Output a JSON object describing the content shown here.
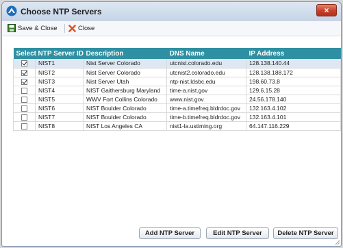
{
  "window": {
    "title": "Choose NTP Servers",
    "close_symbol": "×"
  },
  "toolbar": {
    "save_close_label": "Save & Close",
    "close_label": "Close",
    "save_icon": "save-icon",
    "close_icon": "close-x-icon"
  },
  "table": {
    "columns": [
      "Select",
      "NTP Server ID",
      "Description",
      "DNS Name",
      "IP Address"
    ],
    "rows": [
      {
        "checked": true,
        "id": "NIST1",
        "description": "Nist Server Colorado",
        "dns": "utcnist.colorado.edu",
        "ip": "128.138.140.44"
      },
      {
        "checked": true,
        "id": "NIST2",
        "description": "Nist Server Colorado",
        "dns": "utcnist2.colorado.edu",
        "ip": "128.138.188.172"
      },
      {
        "checked": true,
        "id": "NIST3",
        "description": "Nist Server Utah",
        "dns": "ntp-nist.ldsbc.edu",
        "ip": "198.60.73.8"
      },
      {
        "checked": false,
        "id": "NIST4",
        "description": "NIST Gaithersburg Maryland",
        "dns": "time-a.nist.gov",
        "ip": "129.6.15.28"
      },
      {
        "checked": false,
        "id": "NIST5",
        "description": "WWV Fort Collins Colorado",
        "dns": "www.nist.gov",
        "ip": "24.56.178.140"
      },
      {
        "checked": false,
        "id": "NIST6",
        "description": "NIST Boulder Colorado",
        "dns": "time-a.timefreq.bldrdoc.gov",
        "ip": "132.163.4.102"
      },
      {
        "checked": false,
        "id": "NIST7",
        "description": "NIST Boulder Colorado",
        "dns": "time-b.timefreq.bldrdoc.gov",
        "ip": "132.163.4.101"
      },
      {
        "checked": false,
        "id": "NIST8",
        "description": "NIST Los Angeles CA",
        "dns": "nist1-la.ustiming.org",
        "ip": "64.147.116.229"
      }
    ]
  },
  "buttons": {
    "add": "Add NTP Server",
    "edit": "Edit NTP Server",
    "delete": "Delete NTP Server"
  },
  "colors": {
    "header_bg": "#2e90a2",
    "selected_row": "#dde8f3",
    "close_button": "#c6402a"
  }
}
